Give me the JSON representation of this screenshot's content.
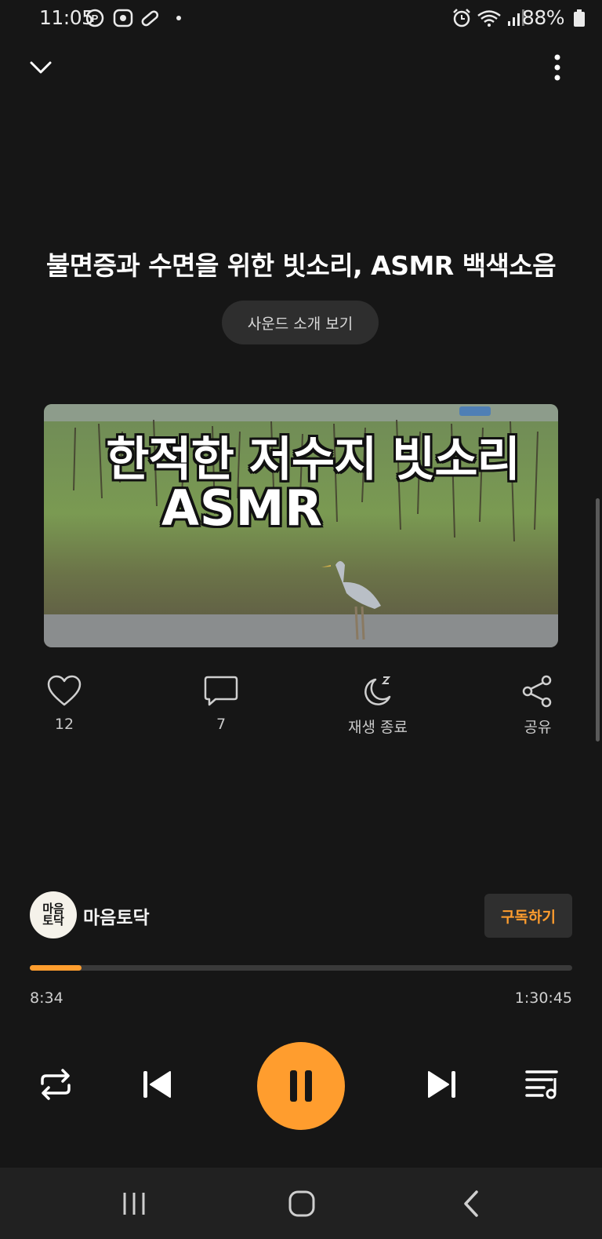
{
  "status_bar": {
    "time": "11:05",
    "battery": "88%",
    "left_icons": [
      "p-icon",
      "screen-recorder-icon",
      "pill-icon",
      "dot-icon"
    ],
    "right_icons": [
      "alarm-icon",
      "wifi-icon",
      "signal-icon",
      "battery-icon"
    ]
  },
  "header": {
    "collapse_icon": "chevron-down-icon",
    "more_icon": "more-vertical-icon"
  },
  "sound": {
    "title": "불면증과 수면을 위한 빗소리, ASMR 백색소음",
    "intro_button": "사운드 소개 보기",
    "artwork_line1": "한적한 저수지 빗소리",
    "artwork_line2": "ASMR"
  },
  "actions": {
    "like_count": "12",
    "comment_count": "7",
    "sleep_timer": "재생 종료",
    "share": "공유"
  },
  "channel": {
    "avatar_text": "마음\n토닥",
    "name": "마음토닥",
    "subscribe": "구독하기"
  },
  "player": {
    "elapsed": "8:34",
    "total": "1:30:45",
    "progress_fraction": 0.095
  },
  "colors": {
    "accent": "#ff9d2e",
    "background": "#161616"
  }
}
